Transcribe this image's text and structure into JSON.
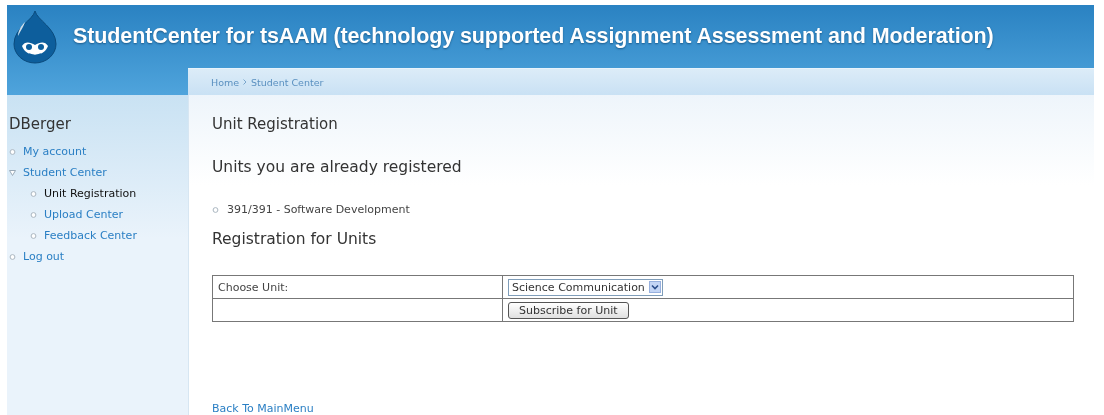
{
  "header": {
    "title": "StudentCenter for tsAAM (technology supported Assignment Assessment and Moderation)"
  },
  "breadcrumb": [
    "Home",
    "Student Center"
  ],
  "sidebar": {
    "user": "DBerger",
    "items": [
      {
        "label": "My account",
        "selected": false,
        "expanded": false
      },
      {
        "label": "Student Center",
        "selected": false,
        "expanded": true,
        "children": [
          {
            "label": "Unit Registration",
            "selected": true
          },
          {
            "label": "Upload Center",
            "selected": false
          },
          {
            "label": "Feedback Center",
            "selected": false
          }
        ]
      },
      {
        "label": "Log out",
        "selected": false,
        "expanded": false
      }
    ]
  },
  "page_title": "Unit Registration",
  "registered_heading": "Units you are already registered",
  "registered_units": [
    "391/391 - Software Development"
  ],
  "registration_heading": "Registration for Units",
  "form": {
    "label": "Choose Unit:",
    "unit_value": "Science Communication",
    "submit": "Subscribe for Unit"
  },
  "back_link": "Back To MainMenu"
}
